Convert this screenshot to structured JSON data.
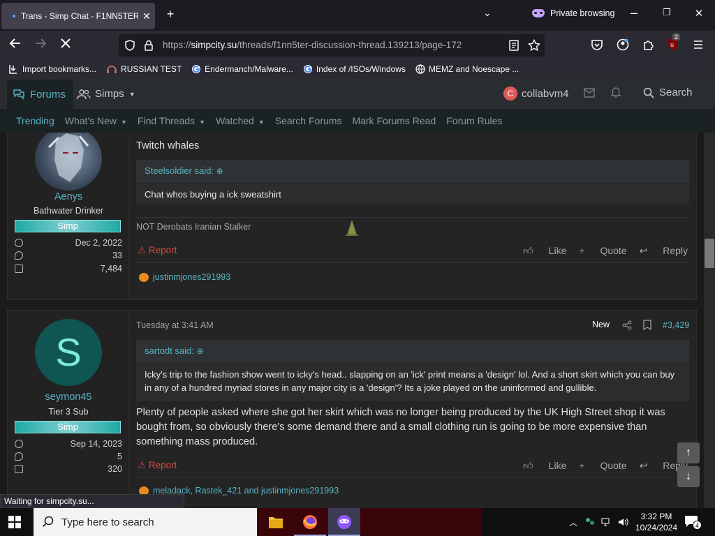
{
  "browser": {
    "tab_title": "Trans - Simp Chat - F1NN5TER ·",
    "tab_close": "✕",
    "new_tab": "+",
    "private_label": "Private browsing",
    "url_prefix": "https://",
    "url_domain": "simpcity.su",
    "url_path": "/threads/f1nn5ter-discussion-thread.139213/page-172",
    "extension_badge": "2",
    "status_text": "Waiting for simpcity.su..."
  },
  "bookmarks": [
    {
      "label": "Import bookmarks..."
    },
    {
      "label": "RUSSIAN TEST"
    },
    {
      "label": "Endermanch/Malware..."
    },
    {
      "label": "Index of /ISOs/Windows"
    },
    {
      "label": "MEMZ and Noescape ..."
    }
  ],
  "site": {
    "forums_label": "Forums",
    "simps_label": "Simps",
    "user_initial": "C",
    "username": "collabvm4",
    "search_label": "Search"
  },
  "subnav": [
    {
      "label": "Trending",
      "caret": false
    },
    {
      "label": "What's New",
      "caret": true
    },
    {
      "label": "Find Threads",
      "caret": true
    },
    {
      "label": "Watched",
      "caret": true
    },
    {
      "label": "Search Forums",
      "caret": false
    },
    {
      "label": "Mark Forums Read",
      "caret": false
    },
    {
      "label": "Forum Rules",
      "caret": false
    }
  ],
  "posts": [
    {
      "author": "Aenys",
      "user_title": "Bathwater Drinker",
      "rank": "Simp",
      "joined": "Dec 2, 2022",
      "messages": "33",
      "reactions_count": "7,484",
      "body": "Twitch whales",
      "quote_author": "Steelsoldier said:",
      "quote_text": "Chat whos buying a ick sweatshirt",
      "signature": "NOT Derobats Iranian Stalker",
      "report": "Report",
      "like": "Like",
      "quote": "Quote",
      "reply": "Reply",
      "reacted_by": "justinmjones291993"
    },
    {
      "author": "seymon45",
      "avatar_letter": "S",
      "user_title": "Tier 3 Sub",
      "rank": "Simp",
      "joined": "Sep 14, 2023",
      "messages": "5",
      "reactions_count": "320",
      "date": "Tuesday at 3:41 AM",
      "new_badge": "New",
      "post_number": "#3,429",
      "quote_author": "sartodt said:",
      "quote_text": "Icky's trip to the fashion show went to icky's head.. slapping on an 'ick' print means a 'design' lol. And a short skirt which you can buy in any of a hundred myriad stores in any major city is a 'design'? Its a joke played on the uninformed and gullible.",
      "body": "Plenty of people asked where she got her skirt which was no longer being produced by the UK High Street shop it was bought from, so obviously there's some demand there and a small clothing run is going to be more expensive than something mass produced.",
      "report": "Report",
      "like": "Like",
      "quote": "Quote",
      "reply": "Reply",
      "reacted_by": "meladack, Rastek_421 and justinmjones291993"
    }
  ],
  "taskbar": {
    "search_placeholder": "Type here to search",
    "time": "3:32 PM",
    "date": "10/24/2024",
    "notification_count": "4"
  },
  "colors": {
    "accent": "#59b3c4",
    "report": "#d34a42",
    "rank_banner": "#1fa9a3"
  }
}
